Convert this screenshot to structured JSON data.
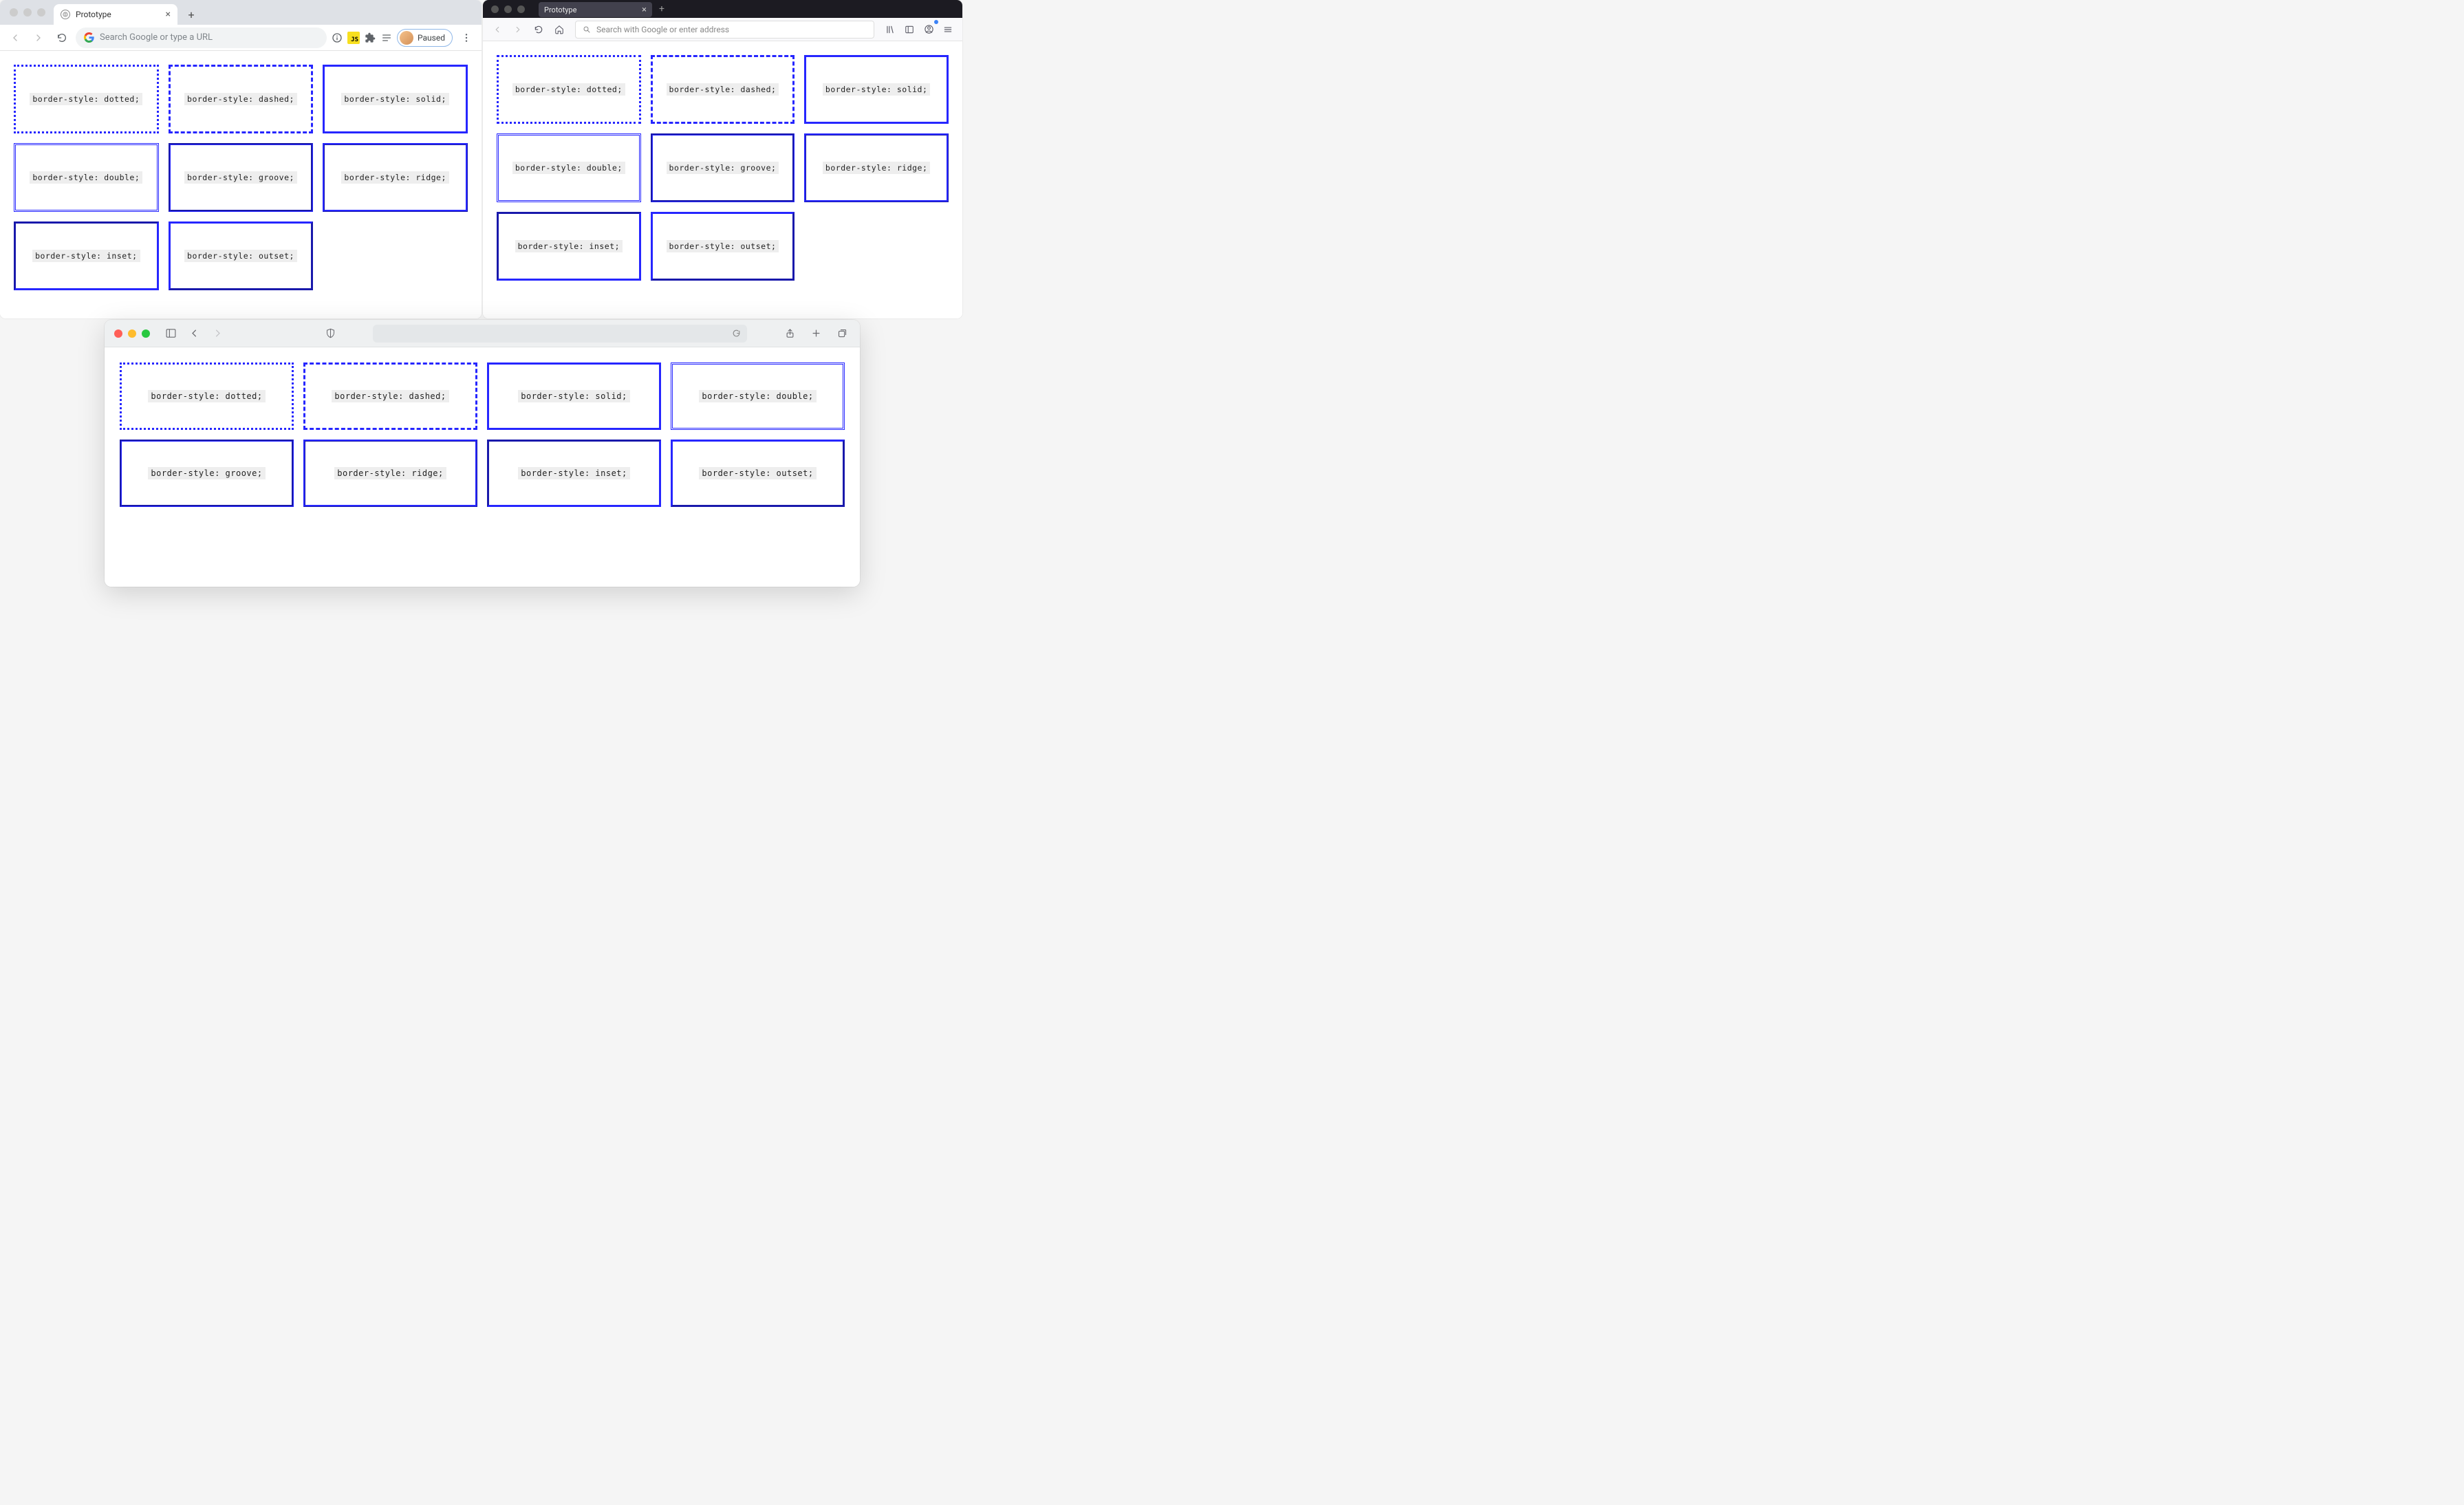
{
  "chrome": {
    "tab_title": "Prototype",
    "omnibox_placeholder": "Search Google or type a URL",
    "paused_label": "Paused",
    "boxes": [
      "border-style: dotted;",
      "border-style: dashed;",
      "border-style: solid;",
      "border-style: double;",
      "border-style: groove;",
      "border-style: ridge;",
      "border-style: inset;",
      "border-style: outset;"
    ]
  },
  "firefox": {
    "tab_title": "Prototype",
    "omnibox_placeholder": "Search with Google or enter address",
    "boxes": [
      "border-style: dotted;",
      "border-style: dashed;",
      "border-style: solid;",
      "border-style: double;",
      "border-style: groove;",
      "border-style: ridge;",
      "border-style: inset;",
      "border-style: outset;"
    ]
  },
  "safari": {
    "boxes": [
      "border-style: dotted;",
      "border-style: dashed;",
      "border-style: solid;",
      "border-style: double;",
      "border-style: groove;",
      "border-style: ridge;",
      "border-style: inset;",
      "border-style: outset;"
    ]
  },
  "border_styles": [
    "dotted",
    "dashed",
    "solid",
    "double",
    "groove",
    "ridge",
    "inset",
    "outset"
  ]
}
